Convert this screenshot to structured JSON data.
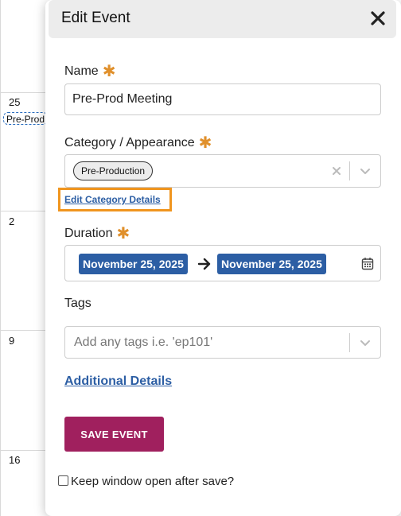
{
  "calendar": {
    "day_numbers": [
      "25",
      "2",
      "9",
      "16"
    ],
    "event_label": "Pre-Prod"
  },
  "modal": {
    "title": "Edit Event",
    "name": {
      "label": "Name",
      "value": "Pre-Prod Meeting"
    },
    "category": {
      "label": "Category / Appearance",
      "selected": "Pre-Production",
      "edit_link": "Edit Category Details"
    },
    "duration": {
      "label": "Duration",
      "start": "November 25, 2025",
      "end": "November 25, 2025"
    },
    "tags": {
      "label": "Tags",
      "placeholder": "Add any tags i.e. 'ep101'"
    },
    "additional_details": "Additional Details",
    "save_label": "SAVE EVENT",
    "keep_open_label": "Keep window open after save?"
  },
  "colors": {
    "accent": "#2c5ea4",
    "save_button": "#a0205e",
    "required_star": "#e0902c",
    "highlight_box": "#f0951e"
  },
  "icons": [
    "close-icon",
    "clear-icon",
    "chevron-down-icon",
    "arrow-right-icon",
    "calendar-icon"
  ]
}
